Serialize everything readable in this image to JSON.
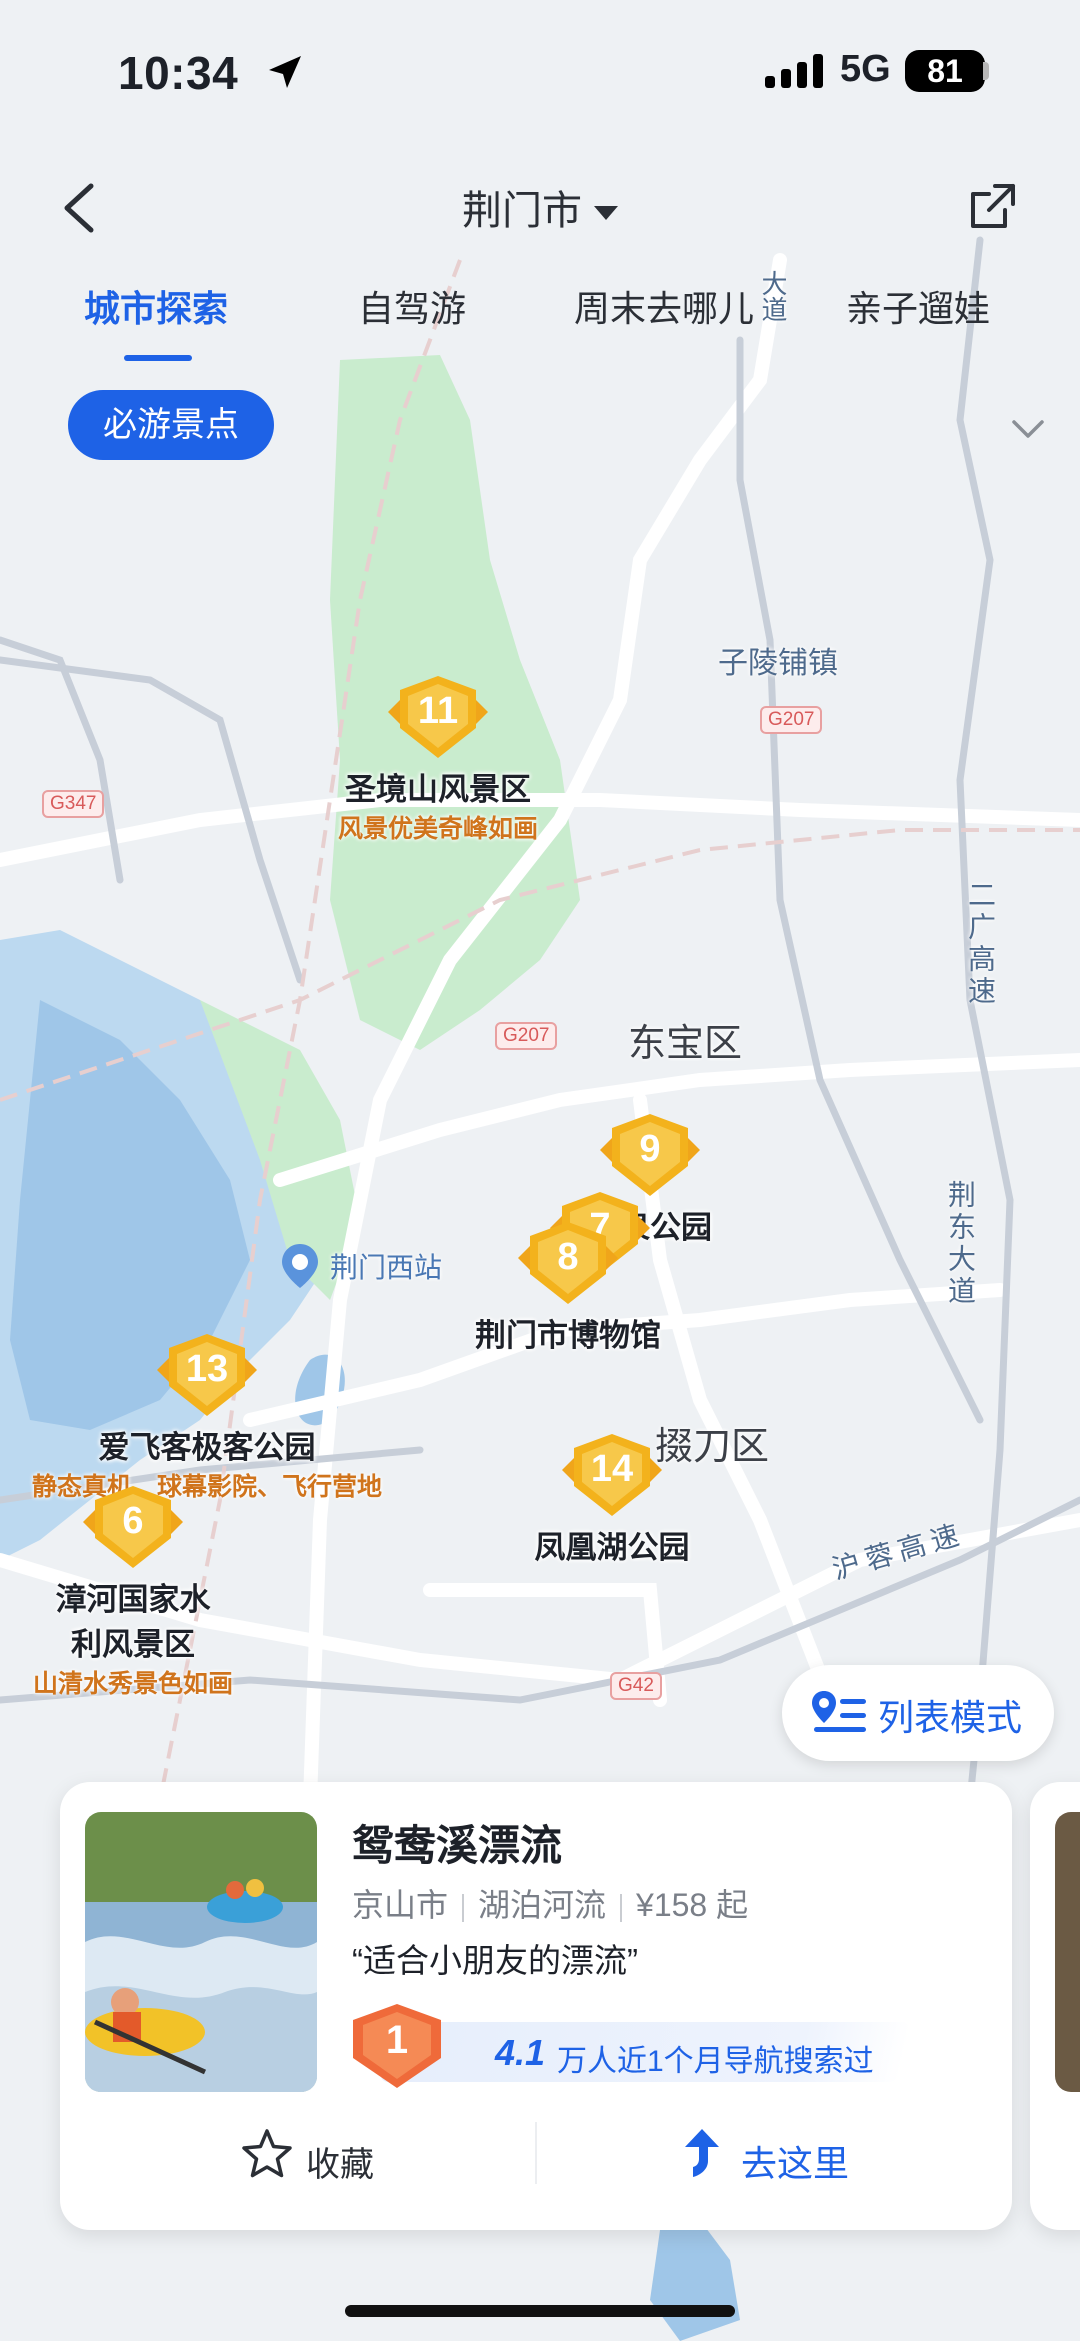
{
  "status_bar": {
    "time": "10:34",
    "network": "5G",
    "battery": "81"
  },
  "header": {
    "title": "荆门市"
  },
  "tabs": [
    {
      "label": "城市探索",
      "active": true
    },
    {
      "label": "自驾游",
      "active": false
    },
    {
      "label": "周末去哪儿",
      "active": false
    },
    {
      "label": "亲子遛娃",
      "active": false
    }
  ],
  "filter_chip": "必游景点",
  "map": {
    "place_labels": [
      "子陵铺镇",
      "东宝区",
      "掇刀区",
      "荆门西站"
    ],
    "road_labels": [
      "二广高速",
      "荆东大道",
      "沪蓉高速",
      "大道"
    ],
    "road_badges": [
      "G347",
      "G207",
      "G207",
      "G42"
    ],
    "pois": [
      {
        "rank": "11",
        "name": "圣境山风景区",
        "sub": "风景优美奇峰如画"
      },
      {
        "rank": "9",
        "name": "龙泉公园",
        "sub": ""
      },
      {
        "rank": "7",
        "name": "",
        "sub": ""
      },
      {
        "rank": "8",
        "name": "荆门市博物馆",
        "sub": ""
      },
      {
        "rank": "13",
        "name": "爱飞客极客公园",
        "sub": "静态真机、球幕影院、飞行营地"
      },
      {
        "rank": "14",
        "name": "凤凰湖公园",
        "sub": ""
      },
      {
        "rank": "6",
        "name_line1": "漳河国家水",
        "name_line2": "利风景区",
        "sub": "山清水秀景色如画"
      }
    ]
  },
  "list_mode_button": "列表模式",
  "card": {
    "title": "鸳鸯溪漂流",
    "city": "京山市",
    "category": "湖泊河流",
    "price": "¥158 起",
    "quote": "“适合小朋友的漂流”",
    "rank": "1",
    "stat_number": "4.1",
    "stat_text": "万人近1个月导航搜索过",
    "favorite_label": "收藏",
    "go_label": "去这里"
  },
  "colors": {
    "accent": "#1e62e6",
    "badge_gold": "#f3b21c",
    "badge_orange": "#e8683a"
  }
}
